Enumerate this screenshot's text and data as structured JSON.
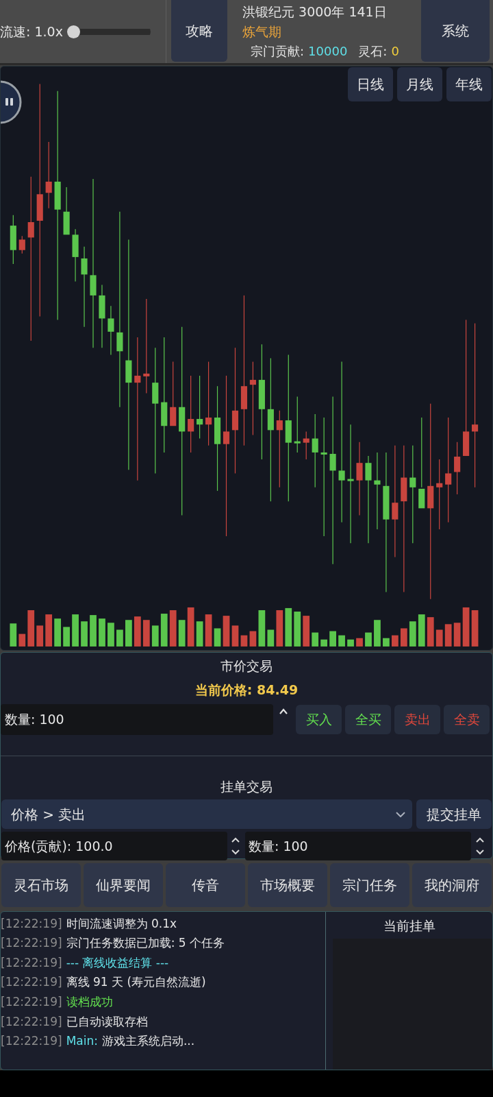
{
  "top_bar": {
    "speed": {
      "label": "流速: 1.0x",
      "level": 0
    },
    "guide_button": "攻略",
    "date": "洪锻纪元 3000年 141日",
    "realm": "炼气期",
    "stats": [
      {
        "label": "宗门贡献:",
        "value": "10000",
        "kind": "contribution"
      },
      {
        "label": "灵石:",
        "value": "0",
        "kind": "spirit_stone"
      }
    ],
    "system_button": "系统"
  },
  "chart": {
    "periods": [
      {
        "label": "日线",
        "selected": false
      },
      {
        "label": "月线",
        "selected": false
      },
      {
        "label": "年线",
        "selected": false
      }
    ]
  },
  "market": {
    "title": "市价交易",
    "price": "当前价格: 84.49",
    "quantity": "数量: 100",
    "actions": [
      {
        "label": "买入",
        "kind": "buy"
      },
      {
        "label": "全买",
        "kind": "buy"
      },
      {
        "label": "卖出",
        "kind": "sell"
      },
      {
        "label": "全卖",
        "kind": "sell"
      }
    ]
  },
  "limit_order": {
    "title": "挂单交易",
    "order_type": "价格 > 卖出",
    "submit": "提交挂单",
    "price": "价格(贡献): 100.0",
    "quantity": "数量: 100"
  },
  "nav": [
    "灵石市场",
    "仙界要闻",
    "传音",
    "市场概要",
    "宗门任务",
    "我的洞府"
  ],
  "log": [
    {
      "time": "[12:22:19]",
      "text": "时间流速调整为 0.1x",
      "kind": "plain"
    },
    {
      "time": "[12:22:19]",
      "text": "宗门任务数据已加载: 5 个任务",
      "kind": "plain"
    },
    {
      "time": "[12:22:19]",
      "text": "--- 离线收益结算 ---",
      "kind": "highlight"
    },
    {
      "time": "[12:22:19]",
      "text": "离线 91 天 (寿元自然流逝)",
      "kind": "plain"
    },
    {
      "time": "[12:22:19]",
      "text": "读档成功",
      "kind": "success"
    },
    {
      "time": "[12:22:19]",
      "text": "已自动读取存档",
      "kind": "plain"
    },
    {
      "time": "[12:22:19]",
      "source": "Main:",
      "text": "游戏主系统启动...",
      "kind": "plain"
    }
  ],
  "orders": {
    "title": "当前挂单"
  }
}
